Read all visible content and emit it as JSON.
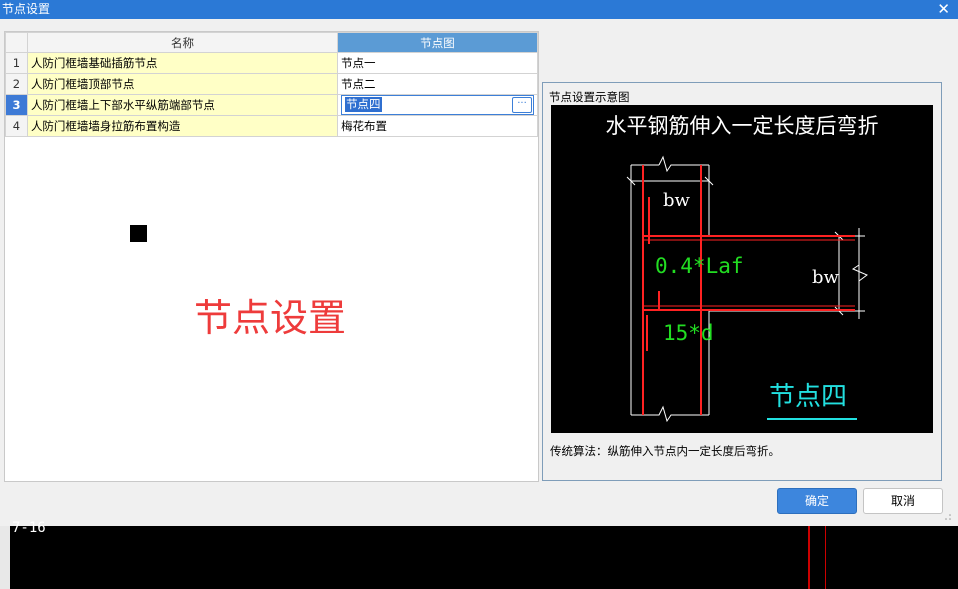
{
  "window": {
    "title": "节点设置",
    "close_glyph": "✕"
  },
  "table": {
    "headers": {
      "num": "",
      "name": "名称",
      "node": "节点图"
    },
    "rows": [
      {
        "num": "1",
        "name": "人防门框墙基础插筋节点",
        "node": "节点一"
      },
      {
        "num": "2",
        "name": "人防门框墙顶部节点",
        "node": "节点二"
      },
      {
        "num": "3",
        "name": "人防门框墙上下部水平纵筋端部节点",
        "node": "节点四"
      },
      {
        "num": "4",
        "name": "人防门框墙墙身拉筋布置构造",
        "node": "梅花布置"
      }
    ],
    "selected_row": 3,
    "ellipsis": "···"
  },
  "watermark": "节点设置",
  "preview": {
    "title": "节点设置示意图",
    "diagram": {
      "heading": "水平钢筋伸入一定长度后弯折",
      "label_bw_top": "bw",
      "label_bw_right": "bw",
      "label_anchor": "0.4*Laf",
      "label_bend": "15*d",
      "node_name": "节点四"
    },
    "algorithm": "传统算法：纵筋伸入节点内一定长度后弯折。"
  },
  "buttons": {
    "ok": "确定",
    "cancel": "取消"
  },
  "background": {
    "label": "7-16"
  },
  "colors": {
    "accent": "#2b79d6",
    "header_blue": "#5b9bd5",
    "name_cell": "#ffffc6",
    "watermark": "#ee3b3b",
    "cad_green": "#22dd22",
    "cad_red": "#ff2222",
    "cad_cyan": "#22e0e0"
  }
}
